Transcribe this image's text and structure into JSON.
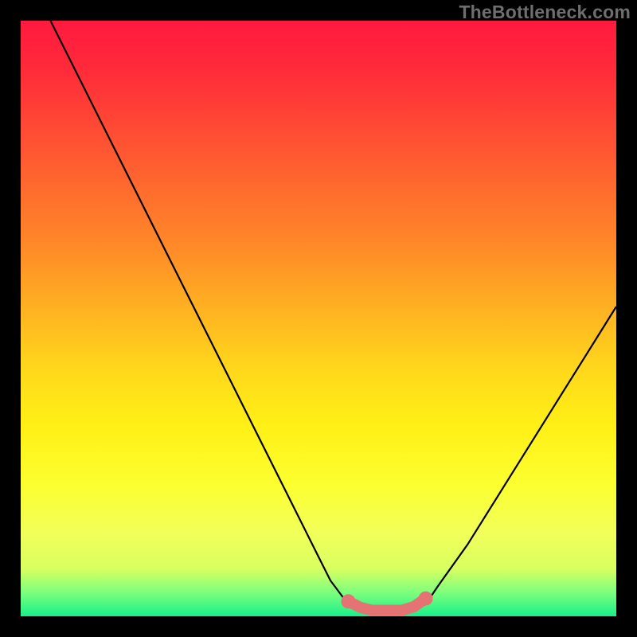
{
  "watermark": "TheBottleneck.com",
  "colors": {
    "frame": "#000000",
    "line": "#000000",
    "marker": "#e57373",
    "gradient_top": "#ff1a3f",
    "gradient_bottom": "#18f08a"
  },
  "chart_data": {
    "type": "line",
    "title": "",
    "xlabel": "",
    "ylabel": "",
    "xlim": [
      0,
      100
    ],
    "ylim": [
      0,
      100
    ],
    "series": [
      {
        "name": "bottleneck-curve",
        "x": [
          5,
          10,
          15,
          20,
          25,
          30,
          35,
          40,
          45,
          50,
          52,
          55,
          58,
          60,
          62,
          64,
          66,
          68,
          70,
          75,
          80,
          85,
          90,
          95,
          100
        ],
        "values": [
          100,
          90,
          80,
          70,
          60,
          50,
          40,
          30,
          20,
          10,
          6,
          2,
          1,
          1,
          1,
          1,
          1,
          2,
          5,
          12,
          20,
          28,
          36,
          44,
          52
        ]
      }
    ],
    "marker_region": {
      "x": [
        55,
        57,
        59,
        60,
        62,
        64,
        66,
        68
      ],
      "values": [
        2.5,
        1.5,
        1,
        1,
        1,
        1,
        1.6,
        3
      ]
    },
    "annotations": []
  }
}
